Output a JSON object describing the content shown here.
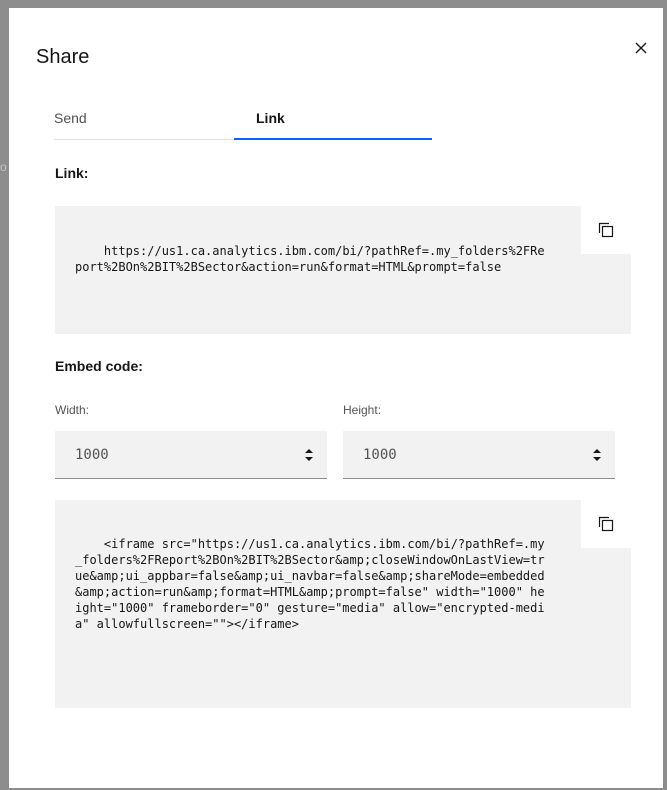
{
  "backdrop": {
    "fragment": "o"
  },
  "dialog": {
    "title": "Share",
    "tabs": [
      {
        "label": "Send",
        "active": false
      },
      {
        "label": "Link",
        "active": true
      }
    ],
    "link": {
      "label": "Link:",
      "url": "https://us1.ca.analytics.ibm.com/bi/?pathRef=.my_folders%2FReport%2BOn%2BIT%2BSector&action=run&format=HTML&prompt=false"
    },
    "embed": {
      "label": "Embed code:",
      "width_label": "Width:",
      "width_value": "1000",
      "height_label": "Height:",
      "height_value": "1000",
      "code": "<iframe src=\"https://us1.ca.analytics.ibm.com/bi/?pathRef=.my_folders%2FReport%2BOn%2BIT%2BSector&amp;closeWindowOnLastView=true&amp;ui_appbar=false&amp;ui_navbar=false&amp;shareMode=embedded&amp;action=run&amp;format=HTML&amp;prompt=false\" width=\"1000\" height=\"1000\" frameborder=\"0\" gesture=\"media\" allow=\"encrypted-media\" allowfullscreen=\"\"></iframe>"
    },
    "icons": {
      "close": "close-icon",
      "copy": "copy-icon",
      "stepper": "stepper-icon"
    },
    "colors": {
      "accent": "#0f62fe",
      "field_bg": "#f2f2f2",
      "overlay": "#8d8d8d"
    }
  }
}
